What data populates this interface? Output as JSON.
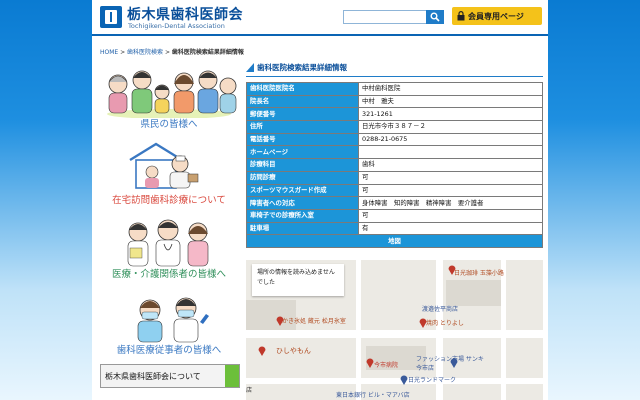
{
  "header": {
    "site_title": "栃木県歯科医師会",
    "site_subtitle": "Tochigiken-Dental Association",
    "search_placeholder": "",
    "member_button": "会員専用ページ"
  },
  "breadcrumb": {
    "home": "HOME",
    "sep1": " > ",
    "search": "歯科医院検索",
    "sep2": " > ",
    "current": "歯科医院検索結果詳細情報"
  },
  "sidebar": {
    "items": [
      {
        "label": "県民の皆様へ"
      },
      {
        "label": "在宅訪問歯科診療について"
      },
      {
        "label": "医療・介護関係者の皆様へ"
      },
      {
        "label": "歯科医療従事者の皆様へ"
      }
    ],
    "about": "栃木県歯科医師会について"
  },
  "main": {
    "title": "歯科医院検索結果詳細情報",
    "rows": [
      {
        "k": "歯科医院医院名",
        "v": "中村歯科医院"
      },
      {
        "k": "院長名",
        "v": "中村　雅夫"
      },
      {
        "k": "郵便番号",
        "v": "321-1261"
      },
      {
        "k": "住所",
        "v": "日光市今市３８７－２"
      },
      {
        "k": "電話番号",
        "v": "0288-21-0675"
      },
      {
        "k": "ホームページ",
        "v": ""
      },
      {
        "k": "診療科目",
        "v": "歯科"
      },
      {
        "k": "訪問診療",
        "v": "可"
      },
      {
        "k": "スポーツマウスガード作成",
        "v": "可"
      },
      {
        "k": "障害者への対応",
        "v": "身体障害　知的障害　精神障害　要介護者"
      },
      {
        "k": "車椅子での診療所入室",
        "v": "可"
      },
      {
        "k": "駐車場",
        "v": "有"
      }
    ],
    "map_header": "地図",
    "map_error": "場所の情報を読み込めませんでした",
    "map_labels": [
      "日光珈琲 玉藻小路",
      "渡邉佐平商店",
      "焼肉 とりよし",
      "かき氷処 蔵元 松月氷室",
      "ひしやもん",
      "今市病院",
      "ファッション市場 サンキ 今市店",
      "日光ランドマーク",
      "東日本銀行 ビル・マアバ店",
      "",
      "店"
    ]
  },
  "colors": {
    "brand": "#0a64b4",
    "table_header": "#1c95d8",
    "member_button": "#f4c21a"
  }
}
